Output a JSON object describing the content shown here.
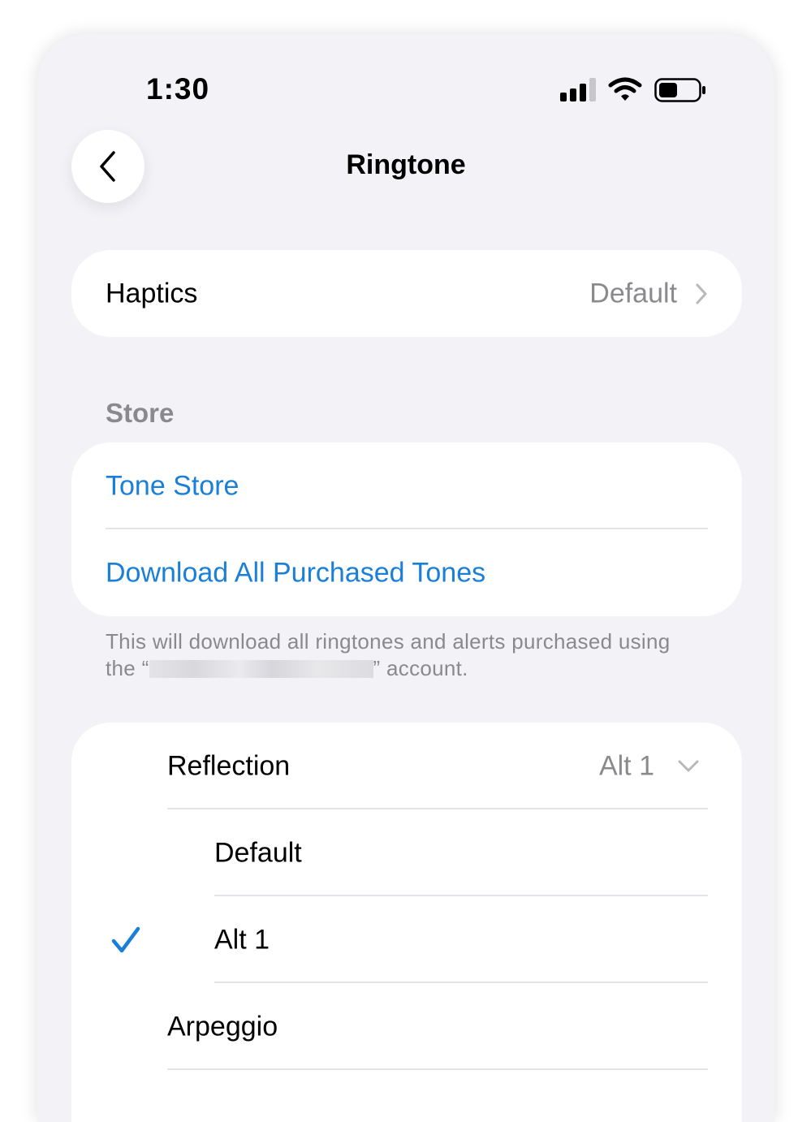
{
  "status_bar": {
    "time": "1:30",
    "icons": [
      "cellular-signal-icon",
      "wifi-icon",
      "battery-icon"
    ]
  },
  "nav": {
    "back_icon": "chevron-left-icon",
    "title": "Ringtone"
  },
  "haptics": {
    "label": "Haptics",
    "value": "Default",
    "icon": "chevron-right-icon"
  },
  "store": {
    "header": "Store",
    "tone_store": "Tone Store",
    "download_all": "Download All Purchased Tones",
    "note_line1": "This will download all ringtones and alerts purchased using",
    "note_prefix": "the “",
    "note_suffix": "” account."
  },
  "tones": {
    "group_label": "Reflection",
    "group_value": "Alt 1",
    "group_icon": "chevron-down-icon",
    "items": [
      {
        "label": "Default",
        "selected": false
      },
      {
        "label": "Alt 1",
        "selected": true
      }
    ],
    "next_label": "Arpeggio"
  },
  "colors": {
    "accent": "#1a7fd9",
    "background": "#f2f2f7",
    "secondary_text": "#8a8a8e"
  }
}
